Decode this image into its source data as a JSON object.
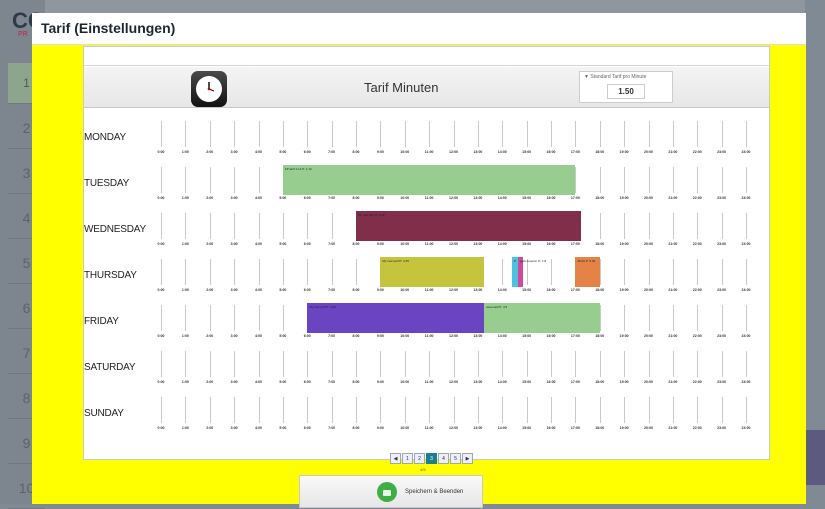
{
  "background": {
    "logo": "CC",
    "logo_sub": "PR",
    "row_numbers": [
      "1",
      "2",
      "3",
      "4",
      "5",
      "6",
      "7",
      "8",
      "9",
      "10"
    ]
  },
  "dialog": {
    "title": "Tarif (Einstellungen)"
  },
  "tariff_panel": {
    "title": "Tarif Minuten",
    "standard_label": "▼ Standard Tarif pro Minute",
    "standard_value": "1.50"
  },
  "hours": [
    "0:00",
    "1:00",
    "2:00",
    "3:00",
    "4:00",
    "5:00",
    "6:00",
    "7:00",
    "8:00",
    "9:00",
    "10:00",
    "11:00",
    "12:00",
    "13:00",
    "14:00",
    "15:00",
    "16:00",
    "17:00",
    "18:00",
    "19:00",
    "20:00",
    "21:00",
    "22:00",
    "23:00",
    "24:00"
  ],
  "days": [
    {
      "name": "MONDAY",
      "bars": []
    },
    {
      "name": "TUESDAY",
      "bars": [
        {
          "label": "FP-tarif 1.12 P: 1.12",
          "start": 5.0,
          "end": 17.0,
          "color": "#97cd8f"
        }
      ]
    },
    {
      "name": "WEDNESDAY",
      "bars": [
        {
          "label": "My new tarif P: 1.12",
          "start": 8.0,
          "end": 17.25,
          "color": "#802e4a"
        }
      ]
    },
    {
      "name": "THURSDAY",
      "bars": [
        {
          "label": "My new tarif P: 4.45",
          "start": 9.0,
          "end": 13.25,
          "color": "#c6c43c"
        },
        {
          "label": "P",
          "start": 14.4,
          "end": 14.65,
          "color": "#4ac2e0"
        },
        {
          "label": "gelb teuerstr. P: 1.8",
          "start": 14.65,
          "end": 14.85,
          "color": "#d14a9a"
        },
        {
          "label": "35.00 P: 5.45",
          "start": 17.0,
          "end": 18.0,
          "color": "#e58347"
        }
      ]
    },
    {
      "name": "FRIDAY",
      "bars": [
        {
          "label": "My new tarif P: 2.93",
          "start": 6.0,
          "end": 13.25,
          "color": "#6b44c2"
        },
        {
          "label": "neue tarif P: 4.5",
          "start": 13.25,
          "end": 18.0,
          "color": "#97cd8f"
        }
      ]
    },
    {
      "name": "SATURDAY",
      "bars": []
    },
    {
      "name": "SUNDAY",
      "bars": []
    }
  ],
  "pager": {
    "pages": [
      "◀",
      "1",
      "2",
      "3",
      "4",
      "5",
      "▶"
    ],
    "active_index": 3,
    "count": "4/5"
  },
  "save_button": {
    "label": "Speichern & Beenden"
  }
}
